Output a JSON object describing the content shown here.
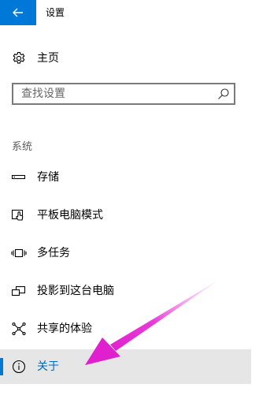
{
  "window": {
    "title": "设置",
    "back_icon": "arrow-left-icon",
    "accent_color": "#0078d7"
  },
  "home": {
    "label": "主页",
    "icon": "gear-icon"
  },
  "search": {
    "placeholder": "查找设置",
    "icon": "search-icon"
  },
  "section": {
    "title": "系统"
  },
  "nav": {
    "items": [
      {
        "label": "存储",
        "icon": "storage-icon",
        "selected": false
      },
      {
        "label": "平板电脑模式",
        "icon": "tablet-mode-icon",
        "selected": false
      },
      {
        "label": "多任务",
        "icon": "multitasking-icon",
        "selected": false
      },
      {
        "label": "投影到这台电脑",
        "icon": "project-to-pc-icon",
        "selected": false
      },
      {
        "label": "共享的体验",
        "icon": "shared-experiences-icon",
        "selected": false
      },
      {
        "label": "关于",
        "icon": "info-icon",
        "selected": true
      }
    ]
  },
  "annotation": {
    "color": "#e83ad8",
    "icon": "annotation-arrow"
  }
}
